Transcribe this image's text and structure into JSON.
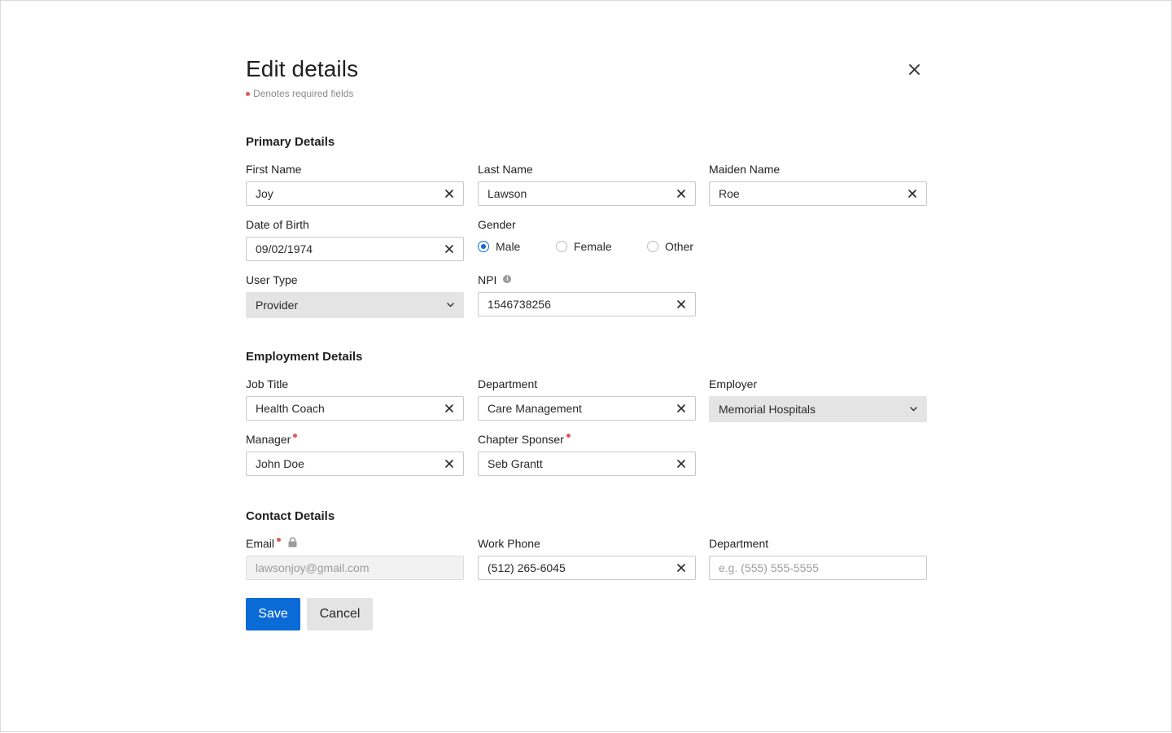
{
  "dialog": {
    "title": "Edit details",
    "required_note": "Denotes required fields"
  },
  "sections": {
    "primary": "Primary Details",
    "employment": "Employment Details",
    "contact": "Contact Details"
  },
  "fields": {
    "first_name": {
      "label": "First Name",
      "value": "Joy"
    },
    "last_name": {
      "label": "Last Name",
      "value": "Lawson"
    },
    "maiden_name": {
      "label": "Maiden Name",
      "value": "Roe"
    },
    "dob": {
      "label": "Date of Birth",
      "value": "09/02/1974"
    },
    "gender": {
      "label": "Gender",
      "options": [
        "Male",
        "Female",
        "Other"
      ],
      "selected": "Male"
    },
    "user_type": {
      "label": "User Type",
      "value": "Provider"
    },
    "npi": {
      "label": "NPI",
      "value": "1546738256"
    },
    "job_title": {
      "label": "Job Title",
      "value": "Health Coach"
    },
    "department": {
      "label": "Department",
      "value": "Care Management"
    },
    "employer": {
      "label": "Employer",
      "value": "Memorial Hospitals"
    },
    "manager": {
      "label": "Manager",
      "value": "John Doe",
      "required": true
    },
    "chapter_sponsor": {
      "label": "Chapter Sponser",
      "value": "Seb Grantt",
      "required": true
    },
    "email": {
      "label": "Email",
      "value": "lawsonjoy@gmail.com",
      "required": true,
      "locked": true
    },
    "work_phone": {
      "label": "Work Phone",
      "value": "(512) 265-6045"
    },
    "contact_department": {
      "label": "Department",
      "placeholder": "e.g. (555) 555-5555"
    }
  },
  "buttons": {
    "save": "Save",
    "cancel": "Cancel"
  },
  "colors": {
    "primary": "#0a6bd6",
    "required": "#e05a55",
    "select_bg": "#e4e4e4"
  },
  "icons": {
    "close": "close-icon",
    "clear": "clear-icon",
    "chevron": "chevron-down-icon",
    "info": "info-icon",
    "lock": "lock-icon"
  }
}
